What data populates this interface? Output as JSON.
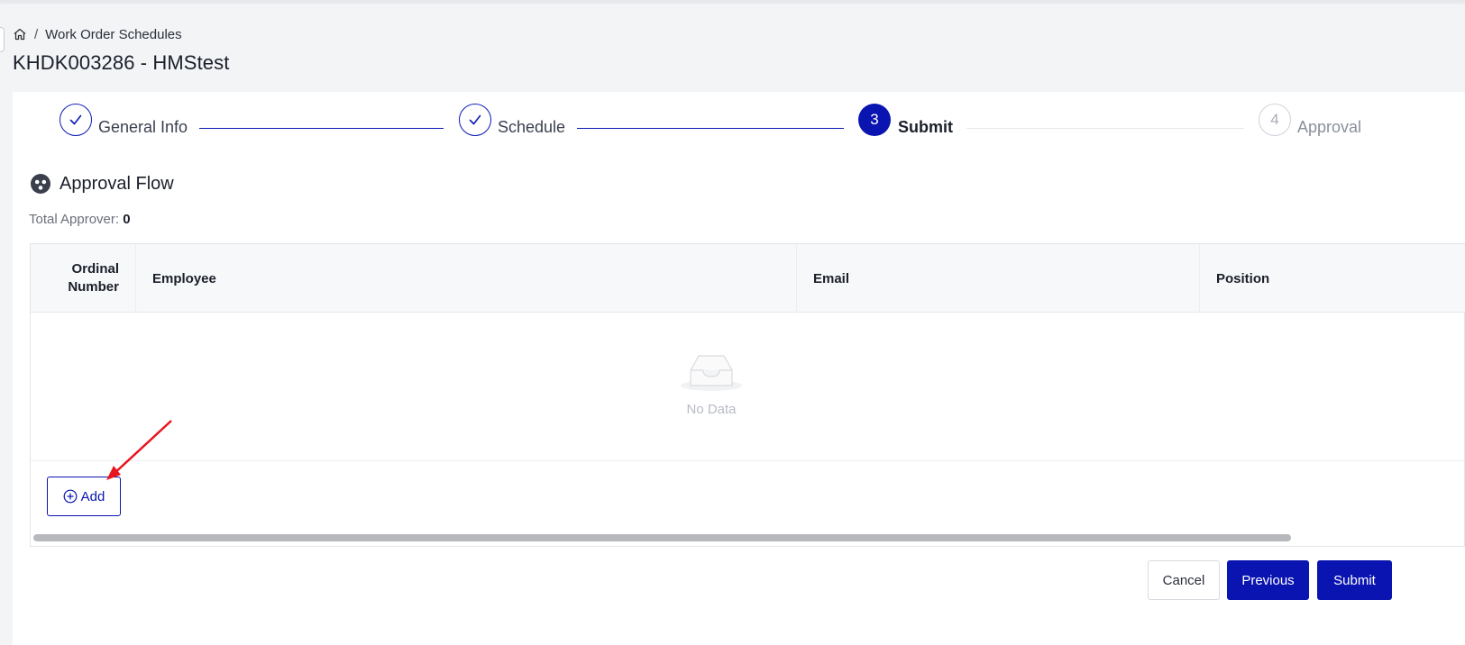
{
  "breadcrumb": {
    "home_icon": "home-icon",
    "separator": "/",
    "current": "Work Order Schedules"
  },
  "page": {
    "title": "KHDK003286 - HMStest"
  },
  "steps": [
    {
      "label": "General Info",
      "state": "done",
      "icon": "check-icon"
    },
    {
      "label": "Schedule",
      "state": "done",
      "icon": "check-icon"
    },
    {
      "label": "Submit",
      "state": "active",
      "number": "3"
    },
    {
      "label": "Approval",
      "state": "todo",
      "number": "4"
    }
  ],
  "section": {
    "title": "Approval Flow",
    "icon": "users-group-icon"
  },
  "total": {
    "label": "Total Approver:",
    "value": "0"
  },
  "table": {
    "columns": [
      "Ordinal Number",
      "Employee",
      "Email",
      "Position"
    ],
    "empty_text": "No Data"
  },
  "add_button": {
    "label": "Add",
    "icon": "plus-circle-icon"
  },
  "footer": {
    "cancel": "Cancel",
    "previous": "Previous",
    "submit": "Submit"
  },
  "colors": {
    "primary": "#0a14b0",
    "annotation_arrow": "#e8141e"
  }
}
